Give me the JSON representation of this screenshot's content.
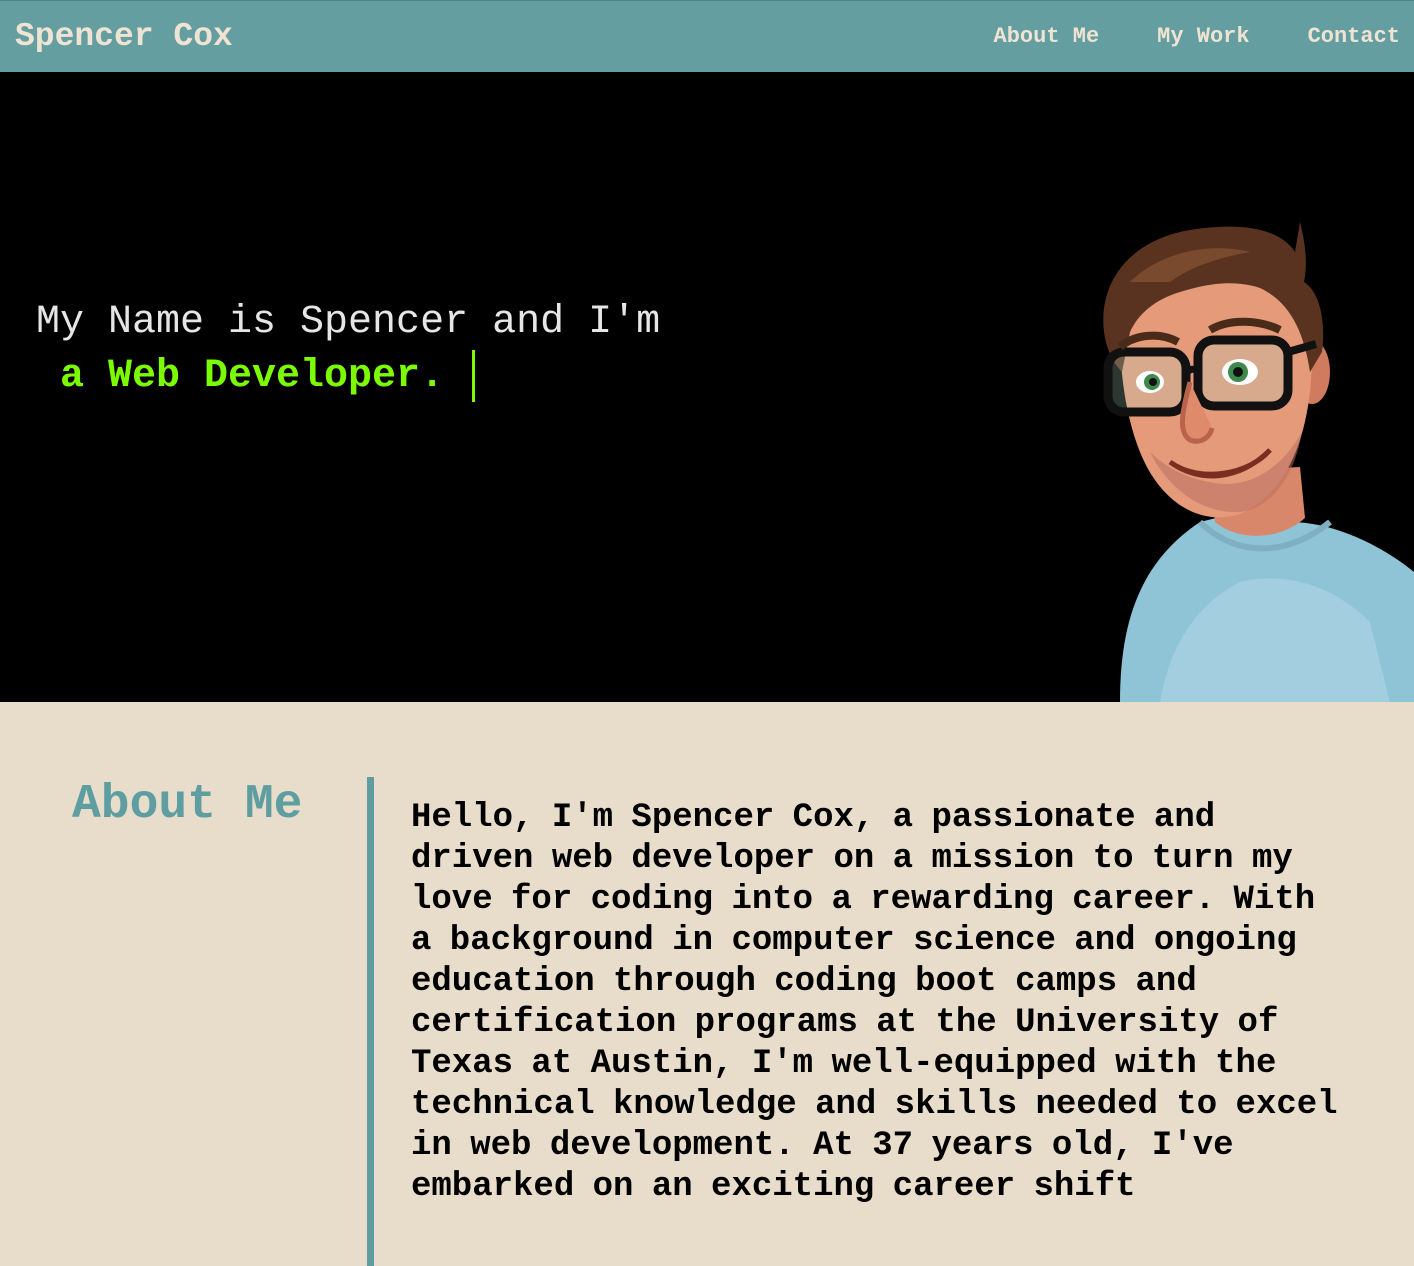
{
  "header": {
    "brand": "Spencer Cox",
    "nav": [
      {
        "label": "About Me"
      },
      {
        "label": "My Work"
      },
      {
        "label": "Contact"
      }
    ]
  },
  "hero": {
    "intro": "My Name is Spencer and I'm",
    "role": " a Web Developer. ",
    "accent_color": "#7cfc00",
    "avatar_icon": "cartoon-avatar-icon"
  },
  "about": {
    "heading": "About Me",
    "body": "Hello, I'm Spencer Cox, a passionate and driven web developer on a mission to turn my love for coding into a rewarding career. With a background in computer science and ongoing education through coding boot camps and certification programs at the University of Texas at Austin, I'm well-equipped with the technical knowledge and skills needed to excel in web development. At 37 years old, I've embarked on an exciting career shift"
  },
  "colors": {
    "nav_bg": "#649ea0",
    "page_bg": "#e8dccb",
    "accent_teal": "#5f9ea0",
    "hero_bg": "#000000"
  }
}
